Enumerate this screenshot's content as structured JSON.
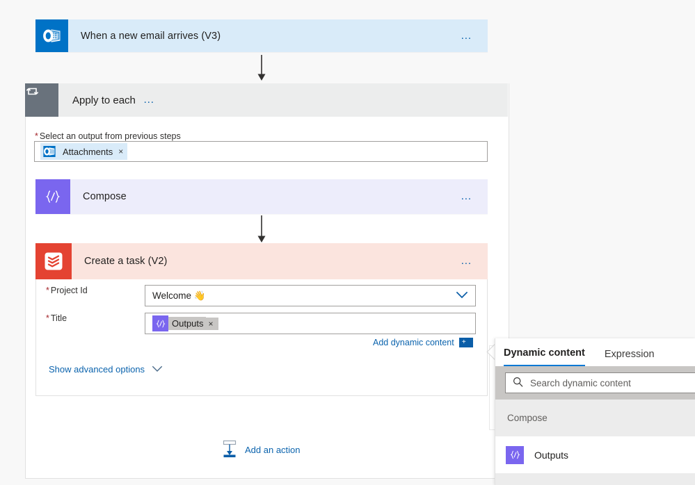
{
  "flow": {
    "trigger": {
      "title": "When a new email arrives (V3)",
      "icon": "outlook-icon",
      "menu_label": "…",
      "header_color": "#d9ebf9",
      "icon_color": "#0072c6"
    },
    "loop": {
      "title": "Apply to each",
      "icon": "loop-icon",
      "menu_label": "…",
      "header_color": "#eceded",
      "icon_color": "#69727c",
      "select_field": {
        "required_mark": "*",
        "label": "Select an output from previous steps",
        "chip": {
          "label": "Attachments",
          "icon": "outlook-icon",
          "remove_label": "×"
        }
      }
    },
    "compose": {
      "title": "Compose",
      "icon": "compose-expression-icon",
      "menu_label": "…",
      "header_color": "#ededfb",
      "icon_color": "#7a66ef"
    },
    "create_task": {
      "title": "Create a task (V2)",
      "icon": "todoist-icon",
      "menu_label": "…",
      "header_color": "#fbe4de",
      "icon_color": "#e44332",
      "fields": [
        {
          "required_mark": "*",
          "label": "Project Id",
          "type": "dropdown",
          "value": "Welcome 👋"
        },
        {
          "required_mark": "*",
          "label": "Title",
          "type": "token",
          "token": {
            "label": "Outputs",
            "icon": "compose-expression-icon",
            "remove_label": "×"
          }
        }
      ],
      "add_dynamic_content": {
        "label": "Add dynamic content",
        "icon": "add-dynamic-content-icon",
        "icon_glyph": "+"
      },
      "show_advanced_options": {
        "label": "Show advanced options",
        "icon": "chevron-down-icon"
      }
    },
    "add_action": {
      "label": "Add an action",
      "icon": "add-action-icon"
    }
  },
  "dynamic_panel": {
    "tabs": [
      {
        "label": "Dynamic content",
        "active": true
      },
      {
        "label": "Expression",
        "active": false
      }
    ],
    "search": {
      "placeholder": "Search dynamic content",
      "value": "",
      "icon": "search-icon"
    },
    "groups": [
      {
        "name": "Compose",
        "items": [
          {
            "label": "Outputs",
            "icon": "compose-expression-icon"
          }
        ]
      }
    ]
  },
  "colors": {
    "accent": "#0078d4",
    "link": "#0b63ad",
    "required": "#a4262c",
    "canvas": "#f8f8f8",
    "outlook": "#0072c6",
    "compose": "#7a66ef",
    "todoist": "#e44332",
    "loop": "#69727c"
  }
}
